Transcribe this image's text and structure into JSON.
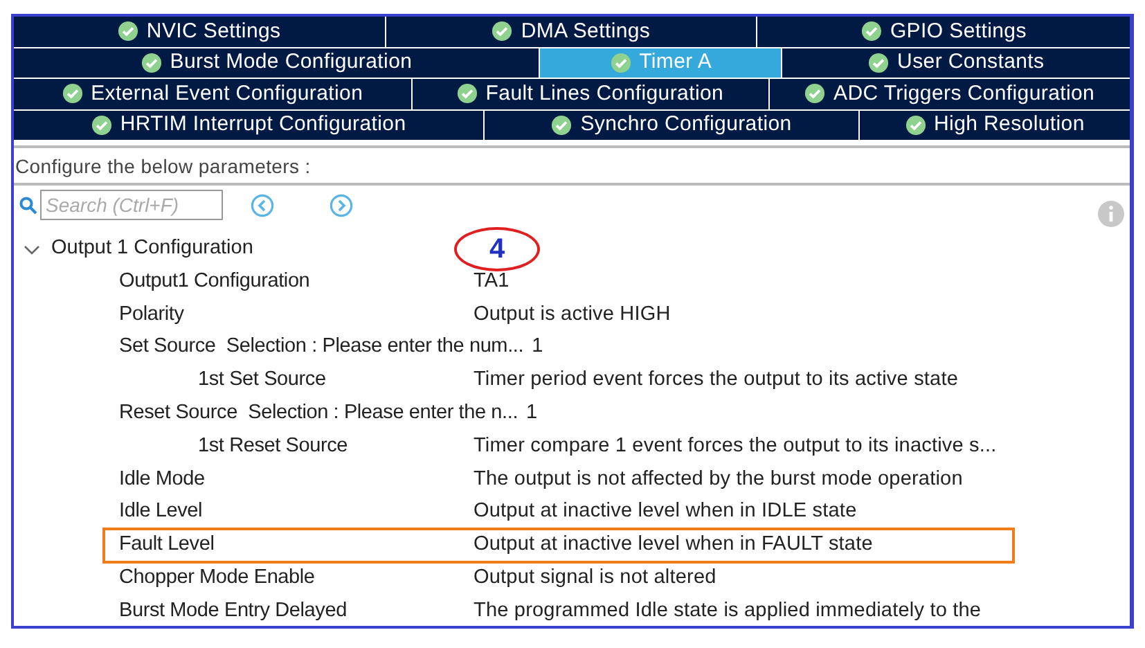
{
  "tab_rows": [
    [
      {
        "label": "NVIC Settings",
        "selected": false
      },
      {
        "label": "DMA Settings",
        "selected": false
      },
      {
        "label": "GPIO Settings",
        "selected": false
      }
    ],
    [
      {
        "label": "Burst Mode Configuration",
        "selected": false
      },
      {
        "label": "Timer A",
        "selected": true
      },
      {
        "label": "User Constants",
        "selected": false
      }
    ],
    [
      {
        "label": "External Event Configuration",
        "selected": false
      },
      {
        "label": "Fault Lines Configuration",
        "selected": false
      },
      {
        "label": "ADC Triggers Configuration",
        "selected": false
      }
    ],
    [
      {
        "label": "HRTIM Interrupt Configuration",
        "selected": false
      },
      {
        "label": "Synchro Configuration",
        "selected": false
      },
      {
        "label": "High Resolution",
        "selected": false
      }
    ]
  ],
  "instruction": "Configure the below parameters :",
  "search": {
    "placeholder": "Search (Ctrl+F)"
  },
  "annotation": {
    "label": "4"
  },
  "group": {
    "label": "Output 1 Configuration",
    "expanded": true,
    "parameters": [
      {
        "name": "Output1 Configuration",
        "value": "TA1",
        "highlighted": false
      },
      {
        "name": "Polarity",
        "value": "Output is active HIGH",
        "highlighted": false
      },
      {
        "name": "Set Source  Selection : Please enter the num...",
        "value": "1",
        "highlighted": false,
        "children": [
          {
            "name": "1st Set Source",
            "value": "Timer period event forces the output to its active state",
            "highlighted": false
          }
        ]
      },
      {
        "name": "Reset Source  Selection : Please enter the n...",
        "value": "1",
        "highlighted": false,
        "children": [
          {
            "name": "1st Reset Source",
            "value": "Timer compare 1 event forces the output to its inactive s...",
            "highlighted": false
          }
        ]
      },
      {
        "name": "Idle Mode",
        "value": "The output is not affected by the burst mode operation",
        "highlighted": false
      },
      {
        "name": "Idle Level",
        "value": "Output at inactive level when in IDLE state",
        "highlighted": false
      },
      {
        "name": "Fault Level",
        "value": "Output at inactive level when in FAULT state",
        "highlighted": true
      },
      {
        "name": "Chopper Mode Enable",
        "value": "Output signal is not altered",
        "highlighted": false
      },
      {
        "name": "Burst Mode Entry Delayed",
        "value": "The programmed Idle state is applied immediately to the",
        "highlighted": false
      }
    ]
  }
}
